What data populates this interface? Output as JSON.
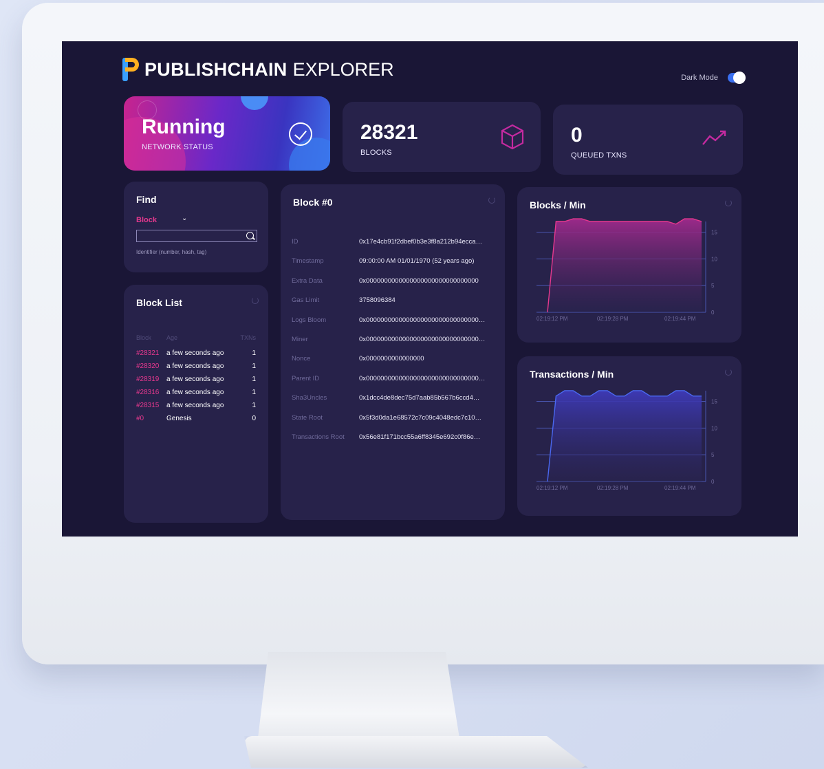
{
  "header": {
    "brand_bold": "PUBLISHCHAIN",
    "brand_light": "EXPLORER",
    "dark_mode_label": "Dark Mode"
  },
  "stats": {
    "status_value": "Running",
    "status_label": "NETWORK STATUS",
    "blocks_value": "28321",
    "blocks_label": "BLOCKS",
    "queued_value": "0",
    "queued_label": "QUEUED TXNS"
  },
  "find": {
    "title": "Find",
    "type_value": "Block",
    "hint": "Identifier (number, hash, tag)"
  },
  "block_list": {
    "title": "Block List",
    "columns": [
      "Block",
      "Age",
      "TXNs"
    ],
    "rows": [
      {
        "block": "#28321",
        "age": "a few seconds ago",
        "txns": "1"
      },
      {
        "block": "#28320",
        "age": "a few seconds ago",
        "txns": "1"
      },
      {
        "block": "#28319",
        "age": "a few seconds ago",
        "txns": "1"
      },
      {
        "block": "#28316",
        "age": "a few seconds ago",
        "txns": "1"
      },
      {
        "block": "#28315",
        "age": "a few seconds ago",
        "txns": "1"
      },
      {
        "block": "#0",
        "age": "Genesis",
        "txns": "0"
      }
    ]
  },
  "block_detail": {
    "title": "Block #0",
    "rows": [
      {
        "key": "ID",
        "value": "0x17e4cb91f2dbef0b3e3f8a212b94ecca…"
      },
      {
        "key": "Timestamp",
        "value": "09:00:00 AM 01/01/1970 (52 years ago)"
      },
      {
        "key": "Extra Data",
        "value": "0x0000000000000000000000000000000"
      },
      {
        "key": "Gas Limit",
        "value": "3758096384"
      },
      {
        "key": "Logs Bloom",
        "value": "0x0000000000000000000000000000000…"
      },
      {
        "key": "Miner",
        "value": "0x0000000000000000000000000000000…"
      },
      {
        "key": "Nonce",
        "value": "0x0000000000000000"
      },
      {
        "key": "Parent ID",
        "value": "0x0000000000000000000000000000000…"
      },
      {
        "key": "Sha3Uncles",
        "value": "0x1dcc4de8dec75d7aab85b567b6ccd4…"
      },
      {
        "key": "State Root",
        "value": "0x5f3d0da1e68572c7c09c4048edc7c10…"
      },
      {
        "key": "Transactions Root",
        "value": "0x56e81f171bcc55a6ff8345e692c0f86e…"
      }
    ]
  },
  "chart_data": [
    {
      "type": "area",
      "title": "Blocks / Min",
      "x": [
        "02:19:12 PM",
        "02:19:28 PM",
        "02:19:44 PM"
      ],
      "yticks": [
        0,
        5,
        10,
        15
      ],
      "ylim": [
        0,
        17
      ],
      "series": [
        {
          "values": [
            0,
            17,
            17,
            17.5,
            17.5,
            17,
            17,
            17,
            17,
            17,
            17,
            17,
            17,
            17,
            17,
            16.5,
            17.5,
            17.5,
            17
          ]
        }
      ],
      "colors": {
        "line": "#e6388e",
        "fill_top": "#a02a8c",
        "fill_bottom": "#2a2450"
      }
    },
    {
      "type": "area",
      "title": "Transactions / Min",
      "x": [
        "02:19:12 PM",
        "02:19:28 PM",
        "02:19:44 PM"
      ],
      "yticks": [
        0,
        5,
        10,
        15
      ],
      "ylim": [
        0,
        17
      ],
      "series": [
        {
          "values": [
            0,
            16,
            17,
            17,
            16,
            16,
            17,
            17,
            16,
            16,
            17,
            17,
            16,
            16,
            16,
            17,
            17,
            16,
            16
          ]
        }
      ],
      "colors": {
        "line": "#4a68f0",
        "fill_top": "#3e3ab8",
        "fill_bottom": "#2a2450"
      }
    }
  ],
  "colors": {
    "accent_pink": "#e6388e",
    "panel": "#27224a",
    "background": "#1a1636"
  }
}
